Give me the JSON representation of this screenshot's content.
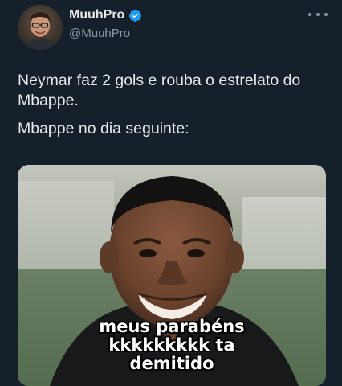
{
  "author": {
    "display_name": "MuuhPro",
    "handle": "@MuuhPro",
    "avatar_icon": "user-avatar",
    "verified_icon": "verified-badge-icon",
    "verified_color": "#1d9bf0"
  },
  "menu_icon": "more-horizontal-icon",
  "tweet": {
    "line1": "Neymar faz 2 gols e rouba o estrelato do Mbappe.",
    "line2": "Mbappe no dia seguinte:"
  },
  "media": {
    "caption_line1": "meus parabéns",
    "caption_line2": "kkkkkkkkk ta",
    "caption_line3": "demitido"
  },
  "theme": {
    "background": "#15202b",
    "text": "#e7e9ea",
    "secondary_text": "#8b98a5"
  }
}
